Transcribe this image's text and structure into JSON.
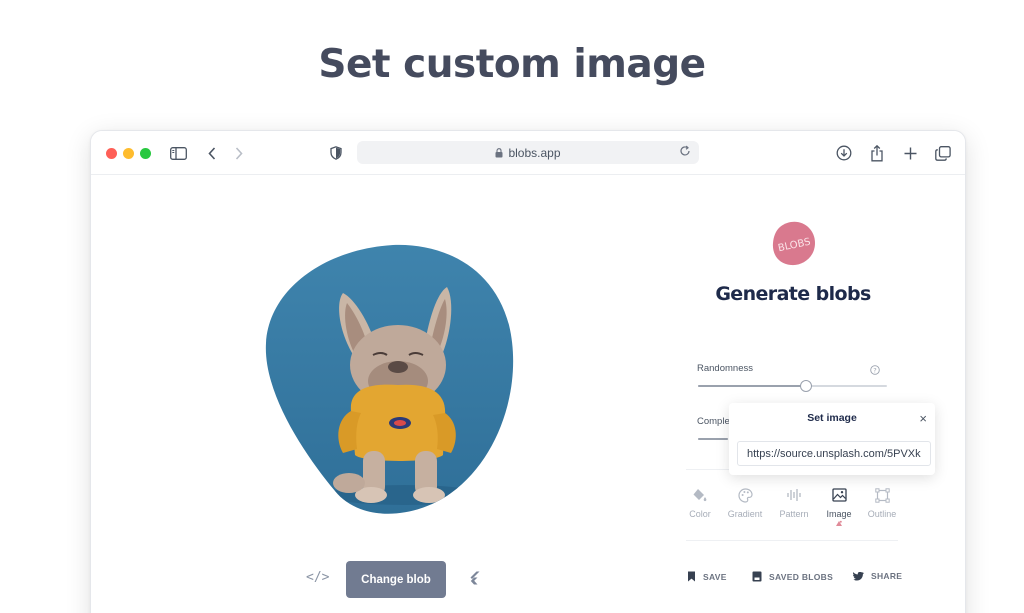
{
  "headline": "Set custom image",
  "browser": {
    "url": "blobs.app"
  },
  "editor": {
    "change_blob_label": "Change blob",
    "code_icon_text": "</>"
  },
  "sidebar": {
    "logo_text": "BLOBS",
    "title": "Generate blobs",
    "randomness_label": "Randomness",
    "randomness_value": 0.57,
    "complexity_label": "Comple",
    "complexity_value": 0.2
  },
  "popover": {
    "title": "Set image",
    "close": "×",
    "url_value": "https://source.unsplash.com/5PVXk"
  },
  "tools": [
    {
      "label": "Color",
      "icon": "paint-bucket-icon",
      "active": false
    },
    {
      "label": "Gradient",
      "icon": "palette-icon",
      "active": false
    },
    {
      "label": "Pattern",
      "icon": "pattern-icon",
      "active": false
    },
    {
      "label": "Image",
      "icon": "image-icon",
      "active": true
    },
    {
      "label": "Outline",
      "icon": "outline-icon",
      "active": false
    }
  ],
  "actions": [
    {
      "label": "SAVE",
      "icon": "bookmark-icon"
    },
    {
      "label": "SAVED BLOBS",
      "icon": "saved-icon"
    },
    {
      "label": "SHARE",
      "icon": "twitter-icon"
    }
  ],
  "colors": {
    "blob_background": "#3f84ad",
    "button": "#717b91",
    "logo": "#d9798e",
    "title": "#1e2a4a"
  }
}
